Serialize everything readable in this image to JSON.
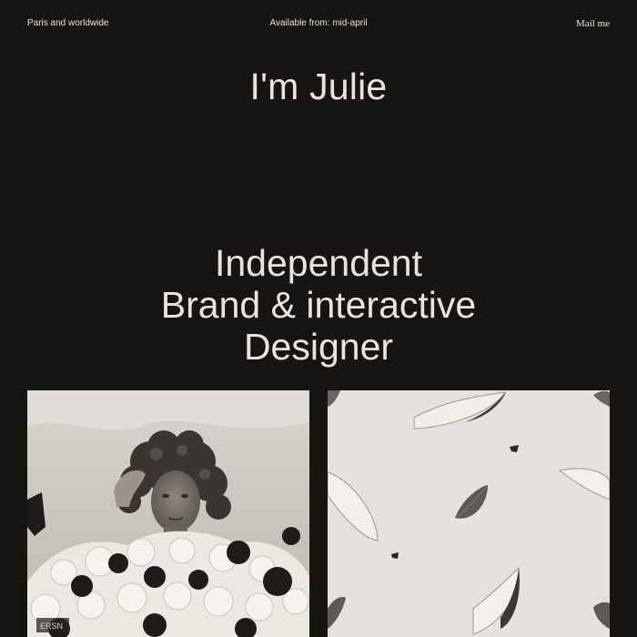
{
  "header": {
    "location": "Paris and worldwide",
    "availability": "Available from: mid-april",
    "contact_label": "Mail me"
  },
  "brand": {
    "title": "I'm Julie"
  },
  "hero": {
    "line1": "Independent",
    "line2": "Brand & interactive",
    "line3": "Designer"
  },
  "gallery": {
    "stamp_text": "ERSN"
  },
  "colors": {
    "background": "#171414",
    "text": "#e9e4dc",
    "card_left": "#d7d2ca",
    "card_right": "#e5e1dc"
  },
  "icons": []
}
